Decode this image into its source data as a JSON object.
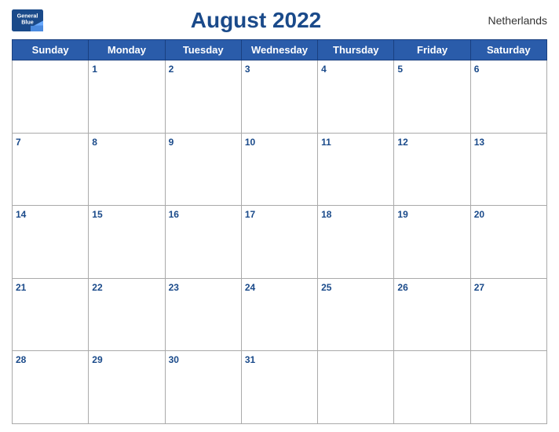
{
  "header": {
    "logo_line1": "General",
    "logo_line2": "Blue",
    "title": "August 2022",
    "country": "Netherlands"
  },
  "days_of_week": [
    "Sunday",
    "Monday",
    "Tuesday",
    "Wednesday",
    "Thursday",
    "Friday",
    "Saturday"
  ],
  "weeks": [
    [
      null,
      1,
      2,
      3,
      4,
      5,
      6
    ],
    [
      7,
      8,
      9,
      10,
      11,
      12,
      13
    ],
    [
      14,
      15,
      16,
      17,
      18,
      19,
      20
    ],
    [
      21,
      22,
      23,
      24,
      25,
      26,
      27
    ],
    [
      28,
      29,
      30,
      31,
      null,
      null,
      null
    ]
  ],
  "accent_color": "#2a5caa"
}
